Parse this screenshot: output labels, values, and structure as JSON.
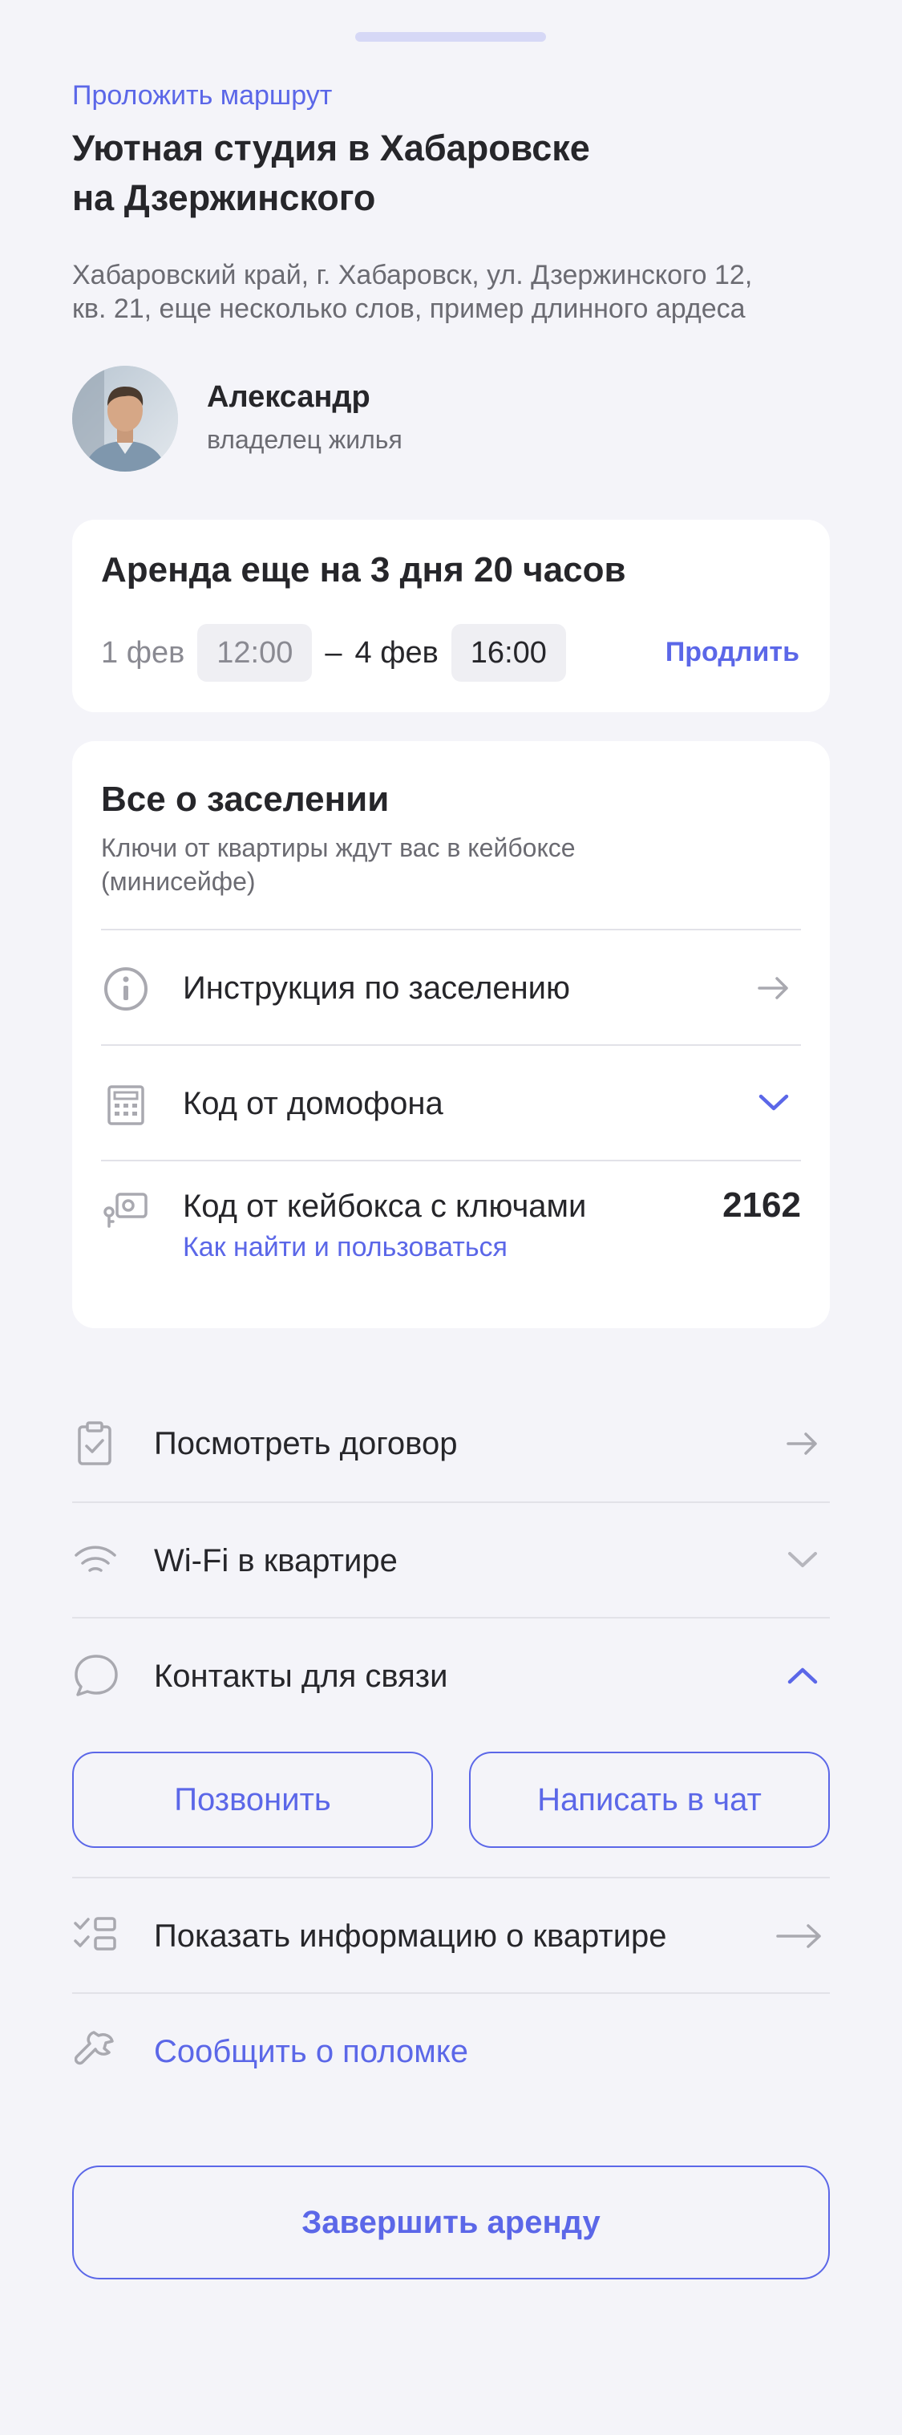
{
  "header": {
    "route_link": "Проложить маршрут",
    "title_line1": "Уютная студия в Хабаровске",
    "title_line2": "на Дзержинского",
    "address_line1": "Хабаровский край, г. Хабаровск, ул. Дзержинского 12,",
    "address_line2": "кв. 21, еще несколько слов, пример длинного ардеса"
  },
  "owner": {
    "name": "Александр",
    "role": "владелец жилья"
  },
  "rent": {
    "title": "Аренда еще на 3 дня 20 часов",
    "start_date": "1 фев",
    "start_time": "12:00",
    "separator": "–",
    "end_date": "4 фев",
    "end_time": "16:00",
    "extend_label": "Продлить"
  },
  "checkin": {
    "title": "Все о заселении",
    "subtitle_line1": "Ключи от квартиры ждут вас в кейбоксе",
    "subtitle_line2": "(минисейфе)",
    "instructions_label": "Инструкция по заселению",
    "intercom_label": "Код от домофона",
    "keybox_label": "Код от кейбокса с ключами",
    "keybox_help": "Как найти и пользоваться",
    "keybox_code": "2162"
  },
  "list": {
    "contract_label": "Посмотреть договор",
    "wifi_label": "Wi-Fi в квартире",
    "contacts_label": "Контакты для связи",
    "call_button": "Позвонить",
    "chat_button": "Написать в чат",
    "apartment_info_label": "Показать информацию о квартире",
    "report_label": "Сообщить о поломке"
  },
  "footer": {
    "finish_button": "Завершить аренду"
  },
  "colors": {
    "accent": "#5b67e8",
    "background": "#f4f4f9",
    "text": "#26262a",
    "muted": "#6b6b72"
  },
  "icons": {
    "instructions": "info-icon",
    "intercom": "intercom-keypad-icon",
    "keybox": "keybox-icon",
    "contract": "clipboard-check-icon",
    "wifi": "wifi-icon",
    "contacts": "chat-bubble-icon",
    "apartment_info": "checklist-icon",
    "report": "wrench-icon"
  }
}
